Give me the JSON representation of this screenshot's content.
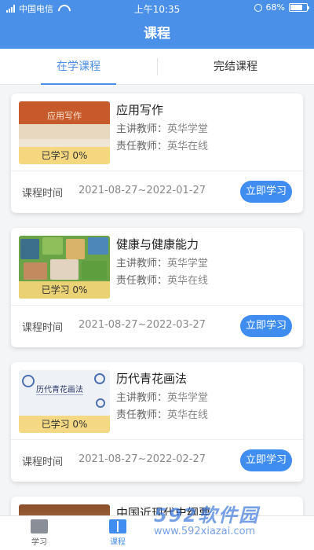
{
  "status": {
    "carrier": "中国电信",
    "time": "上午10:35",
    "battery": "68%",
    "battery_level": 0.68
  },
  "header": {
    "title": "课程"
  },
  "tabs": [
    {
      "label": "在学课程",
      "active": true
    },
    {
      "label": "完结课程",
      "active": false
    }
  ],
  "labels": {
    "main_teacher": "主讲教师：",
    "resp_teacher": "责任教师：",
    "course_time": "课程时间",
    "study_button": "立即学习"
  },
  "courses": [
    {
      "name": "应用写作",
      "thumb_title": "应用写作",
      "progress": "已学习 0%",
      "progress_value": 0,
      "main_teacher": "英华学堂",
      "resp_teacher": "英华在线",
      "dates": "2021-08-27~2022-01-27"
    },
    {
      "name": "健康与健康能力",
      "progress": "已学习 0%",
      "progress_value": 0,
      "main_teacher": "英华学堂",
      "resp_teacher": "英华在线",
      "dates": "2021-08-27~2022-03-27"
    },
    {
      "name": "历代青花画法",
      "thumb_title": "历代青花画法",
      "progress": "已学习 0%",
      "progress_value": 0,
      "main_teacher": "英华学堂",
      "resp_teacher": "英华在线",
      "dates": "2021-08-27~2022-02-27"
    },
    {
      "name": "中国近现代史纲要"
    }
  ],
  "bottom_nav": [
    {
      "label": "学习",
      "icon": "book-closed-icon",
      "active": false
    },
    {
      "label": "课程",
      "icon": "book-open-icon",
      "active": true
    }
  ],
  "watermark": {
    "brand": "592软件园",
    "url": "www.592xiazai.com"
  },
  "colors": {
    "primary": "#4a8fe8",
    "button": "#3f8df0",
    "progress_band": "#f5d678"
  }
}
